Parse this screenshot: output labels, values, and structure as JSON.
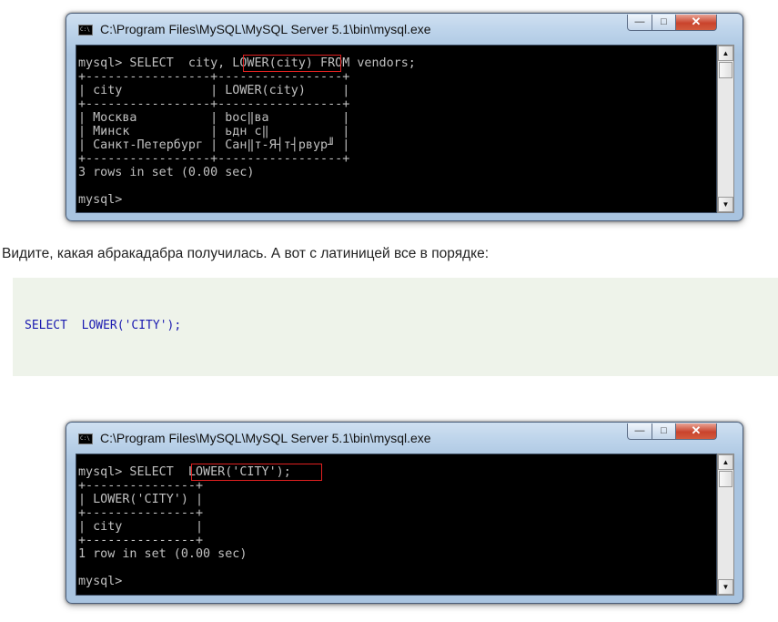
{
  "window1": {
    "title": "C:\\Program Files\\MySQL\\MySQL Server 5.1\\bin\\mysql.exe",
    "controls": {
      "minimize": "—",
      "maximize": "□",
      "close": "✕"
    },
    "lines": [
      "mysql> SELECT  city, LOWER(city) FROM vendors;",
      "+-----------------+-----------------+",
      "| city            | LOWER(city)     |",
      "+-----------------+-----------------+",
      "| Москва          | bос‖ва          |",
      "| Минск           | ьдн с‖          |",
      "| Санкт-Петербург | Сан‖т-Я┤т┤рвур╜ |",
      "+-----------------+-----------------+",
      "3 rows in set (0.00 sec)",
      "",
      "mysql>"
    ]
  },
  "prose_text": "Видите, какая абракадабра получилась. А вот с латиницей все в порядке:",
  "code_snippet": "SELECT  LOWER('CITY');",
  "window2": {
    "title": "C:\\Program Files\\MySQL\\MySQL Server 5.1\\bin\\mysql.exe",
    "controls": {
      "minimize": "—",
      "maximize": "□",
      "close": "✕"
    },
    "lines": [
      "mysql> SELECT  LOWER('CITY');",
      "+---------------+",
      "| LOWER('CITY') |",
      "+---------------+",
      "| city          |",
      "+---------------+",
      "1 row in set (0.00 sec)",
      "",
      "mysql>"
    ]
  },
  "colors": {
    "console_bg": "#000000",
    "console_text": "#c0c0c0",
    "highlight": "#e02020",
    "code_text": "#1a1ab0",
    "code_bg": "#eef3ea"
  }
}
